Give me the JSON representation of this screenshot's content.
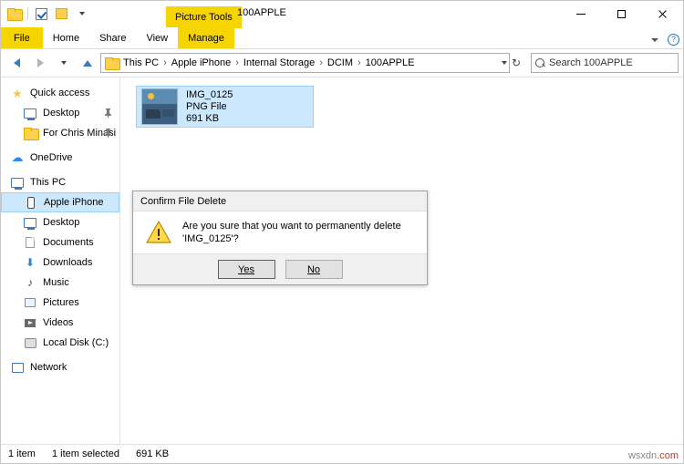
{
  "window": {
    "contextual_tab": "Picture Tools",
    "title": "100APPLE",
    "controls": {
      "minimize": "minimize-button",
      "maximize": "maximize-button",
      "close": "close-button"
    }
  },
  "quick_access_toolbar": {
    "items": [
      "folder-icon",
      "properties-icon",
      "new-folder-icon",
      "customize-caret-icon"
    ]
  },
  "ribbon": {
    "tabs": [
      {
        "label": "File"
      },
      {
        "label": "Home"
      },
      {
        "label": "Share"
      },
      {
        "label": "View"
      },
      {
        "label": "Manage"
      }
    ],
    "collapse_icon": "chevron-down-icon",
    "help": "?"
  },
  "address_bar": {
    "back": "back-arrow-icon",
    "forward": "forward-arrow-icon",
    "recent": "chevron-down-icon",
    "up": "up-arrow-icon",
    "breadcrumbs": [
      "This PC",
      "Apple iPhone",
      "Internal Storage",
      "DCIM",
      "100APPLE"
    ],
    "separator": "›",
    "dropdown": "chevron-down-icon",
    "refresh": "↻",
    "search_placeholder": "Search 100APPLE"
  },
  "sidebar": {
    "items": [
      {
        "label": "Quick access",
        "icon": "star-icon",
        "indent": 0,
        "pinned": false,
        "selected": false
      },
      {
        "label": "Desktop",
        "icon": "desktop-icon",
        "indent": 1,
        "pinned": true,
        "selected": false
      },
      {
        "label": "For Chris Minasi",
        "icon": "folder-icon",
        "indent": 1,
        "pinned": true,
        "selected": false
      },
      {
        "label": "OneDrive",
        "icon": "onedrive-icon",
        "indent": 0,
        "pinned": false,
        "selected": false
      },
      {
        "label": "This PC",
        "icon": "pc-icon",
        "indent": 0,
        "pinned": false,
        "selected": false
      },
      {
        "label": "Apple iPhone",
        "icon": "phone-icon",
        "indent": 1,
        "pinned": false,
        "selected": true
      },
      {
        "label": "Desktop",
        "icon": "desktop-icon",
        "indent": 1,
        "pinned": false,
        "selected": false
      },
      {
        "label": "Documents",
        "icon": "documents-icon",
        "indent": 1,
        "pinned": false,
        "selected": false
      },
      {
        "label": "Downloads",
        "icon": "downloads-icon",
        "indent": 1,
        "pinned": false,
        "selected": false
      },
      {
        "label": "Music",
        "icon": "music-icon",
        "indent": 1,
        "pinned": false,
        "selected": false
      },
      {
        "label": "Pictures",
        "icon": "pictures-icon",
        "indent": 1,
        "pinned": false,
        "selected": false
      },
      {
        "label": "Videos",
        "icon": "videos-icon",
        "indent": 1,
        "pinned": false,
        "selected": false
      },
      {
        "label": "Local Disk (C:)",
        "icon": "disk-icon",
        "indent": 1,
        "pinned": false,
        "selected": false
      },
      {
        "label": "Network",
        "icon": "network-icon",
        "indent": 0,
        "pinned": false,
        "selected": false
      }
    ]
  },
  "file_list": {
    "items": [
      {
        "name": "IMG_0125",
        "type": "PNG File",
        "size": "691 KB",
        "selected": true
      }
    ]
  },
  "status_bar": {
    "item_count": "1 item",
    "selection": "1 item selected",
    "selection_size": "691 KB"
  },
  "dialog": {
    "title": "Confirm File Delete",
    "icon": "warning-icon",
    "message": "Are you sure that you want to permanently delete 'IMG_0125'?",
    "buttons": [
      {
        "label": "Yes",
        "accesskey": "Y",
        "default": true
      },
      {
        "label": "No",
        "accesskey": "N",
        "default": false
      }
    ]
  },
  "watermark": {
    "part1": "wsxdn",
    "part2": ".com"
  },
  "colors": {
    "accent": "#cce8ff",
    "accent_border": "#99d1ff",
    "ribbon_yellow": "#f5d400",
    "link_blue": "#3a7bbf"
  }
}
